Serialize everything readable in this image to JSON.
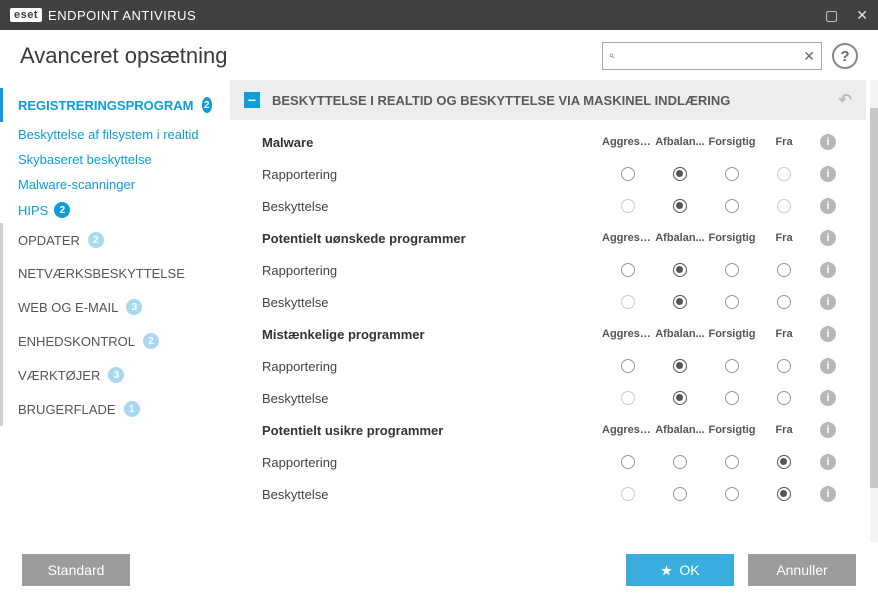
{
  "titlebar": {
    "brand": "eset",
    "title": "ENDPOINT ANTIVIRUS"
  },
  "header": {
    "title": "Avanceret opsætning",
    "help": "?"
  },
  "search": {
    "placeholder": ""
  },
  "sidebar": {
    "items": [
      {
        "label": "REGISTRERINGSPROGRAM",
        "badge": "2",
        "active": true,
        "sub": [
          {
            "label": "Beskyttelse af filsystem i realtid"
          },
          {
            "label": "Skybaseret beskyttelse"
          },
          {
            "label": "Malware-scanninger"
          },
          {
            "label": "HIPS",
            "badge": "2"
          }
        ]
      },
      {
        "label": "OPDATER",
        "badge": "2"
      },
      {
        "label": "NETVÆRKSBESKYTTELSE"
      },
      {
        "label": "WEB OG E-MAIL",
        "badge": "3"
      },
      {
        "label": "ENHEDSKONTROL",
        "badge": "2"
      },
      {
        "label": "VÆRKTØJER",
        "badge": "3"
      },
      {
        "label": "BRUGERFLADE",
        "badge": "1"
      }
    ]
  },
  "section": {
    "title": "BESKYTTELSE I REALTID OG BESKYTTELSE VIA MASKINEL INDLÆRING",
    "columns": [
      "Aggressiv",
      "Afbalan...",
      "Forsigtig",
      "Fra"
    ],
    "groups": [
      {
        "title": "Malware",
        "rows": [
          {
            "label": "Rapportering",
            "selected": 1,
            "disabled": [
              3
            ]
          },
          {
            "label": "Beskyttelse",
            "selected": 1,
            "disabled": [
              0,
              3
            ]
          }
        ]
      },
      {
        "title": "Potentielt uønskede programmer",
        "rows": [
          {
            "label": "Rapportering",
            "selected": 1
          },
          {
            "label": "Beskyttelse",
            "selected": 1,
            "disabled": [
              0
            ]
          }
        ]
      },
      {
        "title": "Mistænkelige programmer",
        "rows": [
          {
            "label": "Rapportering",
            "selected": 1
          },
          {
            "label": "Beskyttelse",
            "selected": 1,
            "disabled": [
              0
            ]
          }
        ]
      },
      {
        "title": "Potentielt usikre programmer",
        "rows": [
          {
            "label": "Rapportering",
            "selected": 3
          },
          {
            "label": "Beskyttelse",
            "selected": 3,
            "disabled": [
              0
            ]
          }
        ]
      }
    ]
  },
  "footer": {
    "default": "Standard",
    "ok": "OK",
    "cancel": "Annuller"
  }
}
